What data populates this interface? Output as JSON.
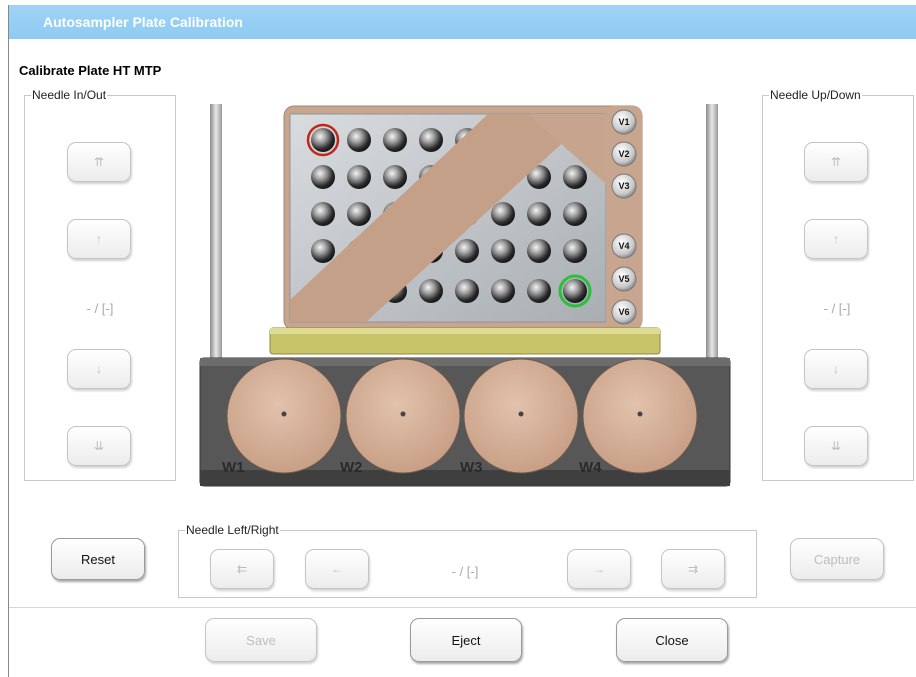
{
  "window": {
    "title": "Autosampler Plate Calibration"
  },
  "heading": "Calibrate Plate HT MTP",
  "needle_in_out": {
    "legend": "Needle In/Out",
    "btn1": "⇈",
    "btn2": "↑",
    "status": "- / [-]",
    "btn3": "↓",
    "btn4": "⇊"
  },
  "needle_up_down": {
    "legend": "Needle Up/Down",
    "btn1": "⇈",
    "btn2": "↑",
    "status": "- / [-]",
    "btn3": "↓",
    "btn4": "⇊"
  },
  "needle_left_right": {
    "legend": "Needle Left/Right",
    "btn1": "⇇",
    "btn2": "←",
    "status": "- / [-]",
    "btn3": "→",
    "btn4": "⇉"
  },
  "plate": {
    "vials": [
      "V1",
      "V2",
      "V3",
      "V4",
      "V5",
      "V6"
    ],
    "wells": [
      "W1",
      "W2",
      "W3",
      "W4"
    ],
    "colors": {
      "copper": "#c9a48c",
      "plate": "#bfc4c8",
      "tray": "#5a5a5a",
      "holder": "#c9c56a",
      "selected_red": "#c0281c",
      "selected_green": "#2bbf3a"
    }
  },
  "buttons": {
    "reset": "Reset",
    "capture": "Capture",
    "save": "Save",
    "eject": "Eject",
    "close": "Close"
  }
}
